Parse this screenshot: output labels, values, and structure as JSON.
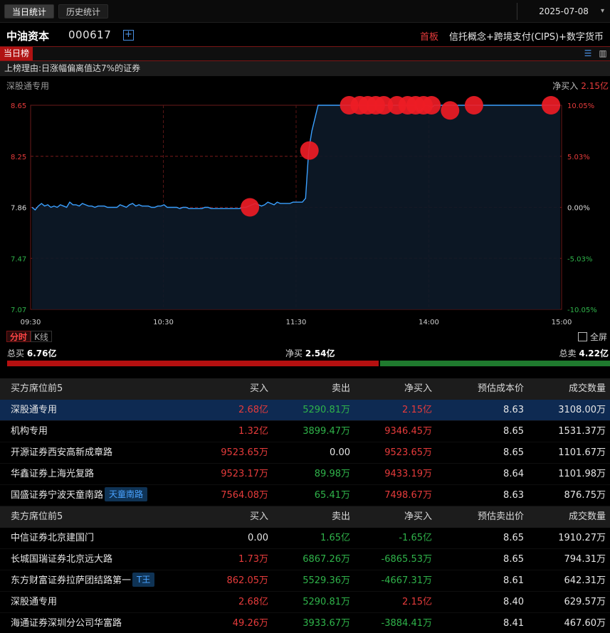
{
  "tabs": [
    {
      "label": "当日统计",
      "active": true
    },
    {
      "label": "历史统计",
      "active": false
    }
  ],
  "date": "2025-07-08",
  "stock": {
    "name": "中油资本",
    "code": "000617",
    "board": "首板",
    "concept": "信托概念+跨境支付(CIPS)+数字货币"
  },
  "rank_tag": "当日榜",
  "reason": "上榜理由:日涨幅偏离值达7%的证券",
  "seat_name": "深股通专用",
  "net_buy_label": "净买入",
  "net_buy_value": "2.15亿",
  "chart_data": {
    "type": "line",
    "y_labels": [
      "8.65",
      "8.25",
      "7.86",
      "7.47",
      "7.07"
    ],
    "pct_labels": [
      "10.05%",
      "5.03%",
      "0.00%",
      "-5.03%",
      "-10.05%"
    ],
    "x_labels": [
      "09:30",
      "10:30",
      "11:30",
      "14:00",
      "15:00"
    ],
    "ylim": [
      7.07,
      8.65
    ],
    "prev_close": 7.86,
    "series": [
      {
        "values": [
          7.86,
          7.84,
          7.87,
          7.89,
          7.87,
          7.88,
          7.86,
          7.87,
          7.86,
          7.88,
          7.87,
          7.86,
          7.9,
          7.88,
          7.88,
          7.87,
          7.89,
          7.88,
          7.87,
          7.87,
          7.86,
          7.87,
          7.87,
          7.87,
          7.86,
          7.86,
          7.86,
          7.86,
          7.88,
          7.87,
          7.86,
          7.88,
          7.89,
          7.87,
          7.88,
          7.87,
          7.87,
          7.87,
          7.86,
          7.86,
          7.87,
          7.87,
          7.88,
          7.86,
          7.86,
          7.86,
          7.86,
          7.85,
          7.86,
          7.86,
          7.85,
          7.85,
          7.85,
          7.85,
          7.85,
          7.86,
          7.86,
          7.85,
          7.85,
          7.85,
          7.85,
          7.85,
          7.85,
          7.85,
          7.85,
          7.85,
          7.85,
          7.86,
          7.86,
          7.87,
          7.88,
          7.89,
          7.88,
          7.87,
          7.88,
          7.9,
          7.89,
          7.88,
          7.9,
          7.89,
          7.89,
          7.89,
          7.89,
          7.9,
          7.9,
          7.9,
          7.9,
          7.93,
          8.3,
          8.45,
          8.55,
          8.65,
          8.65,
          8.65,
          8.65,
          8.65,
          8.65,
          8.65,
          8.65,
          8.65,
          8.65,
          8.65,
          8.65,
          8.65,
          8.65,
          8.65,
          8.65,
          8.65,
          8.65,
          8.65,
          8.65,
          8.65,
          8.65,
          8.65,
          8.65,
          8.65,
          8.65,
          8.65,
          8.65,
          8.65,
          8.65,
          8.65,
          8.65,
          8.6,
          8.62,
          8.65,
          8.65,
          8.63,
          8.65,
          8.65,
          8.65,
          8.65,
          8.65,
          8.65,
          8.65,
          8.65,
          8.65,
          8.65,
          8.65,
          8.65,
          8.65,
          8.65,
          8.65,
          8.65,
          8.65,
          8.65,
          8.65,
          8.65,
          8.65,
          8.65,
          8.65,
          8.65,
          8.65,
          8.65,
          8.65,
          8.65,
          8.65,
          8.65,
          8.65,
          8.65,
          8.65,
          8.65,
          8.65,
          8.65,
          8.65,
          8.65,
          8.65,
          8.65,
          8.65
        ]
      }
    ],
    "markers": [
      {
        "t": 0.413,
        "v": 7.86
      },
      {
        "t": 0.525,
        "v": 8.3
      },
      {
        "t": 0.6,
        "v": 8.65
      },
      {
        "t": 0.62,
        "v": 8.65
      },
      {
        "t": 0.635,
        "v": 8.65
      },
      {
        "t": 0.65,
        "v": 8.65
      },
      {
        "t": 0.665,
        "v": 8.65
      },
      {
        "t": 0.69,
        "v": 8.65
      },
      {
        "t": 0.71,
        "v": 8.65
      },
      {
        "t": 0.725,
        "v": 8.65
      },
      {
        "t": 0.74,
        "v": 8.65
      },
      {
        "t": 0.755,
        "v": 8.65
      },
      {
        "t": 0.79,
        "v": 8.61
      },
      {
        "t": 0.835,
        "v": 8.65
      },
      {
        "t": 0.98,
        "v": 8.65
      }
    ]
  },
  "chart_tabs": {
    "active": "分时",
    "inactive": "K线",
    "fullscreen": "全屏"
  },
  "summary": {
    "total_buy_label": "总买",
    "total_buy": "6.76亿",
    "net_buy_label": "净买",
    "net_buy": "2.54亿",
    "total_sell_label": "总卖",
    "total_sell": "4.22亿",
    "buy_ratio": 0.616
  },
  "buy_table": {
    "headers": [
      "买方席位前5",
      "买入",
      "卖出",
      "净买入",
      "预估成本价",
      "成交数量"
    ],
    "rows": [
      {
        "name": "深股通专用",
        "tag": "",
        "buy": "2.68亿",
        "sell": "5290.81万",
        "net": "2.15亿",
        "price": "8.63",
        "vol": "3108.00万",
        "hl": true
      },
      {
        "name": "机构专用",
        "tag": "",
        "buy": "1.32亿",
        "sell": "3899.47万",
        "net": "9346.45万",
        "price": "8.65",
        "vol": "1531.37万",
        "hl": false
      },
      {
        "name": "开源证券西安高新成章路",
        "tag": "",
        "buy": "9523.65万",
        "sell": "0.00",
        "net": "9523.65万",
        "price": "8.65",
        "vol": "1101.67万",
        "hl": false
      },
      {
        "name": "华鑫证券上海光复路",
        "tag": "",
        "buy": "9523.17万",
        "sell": "89.98万",
        "net": "9433.19万",
        "price": "8.64",
        "vol": "1101.98万",
        "hl": false
      },
      {
        "name": "国盛证券宁波天童南路",
        "tag": "天童南路",
        "buy": "7564.08万",
        "sell": "65.41万",
        "net": "7498.67万",
        "price": "8.63",
        "vol": "876.75万",
        "hl": false
      }
    ]
  },
  "sell_table": {
    "headers": [
      "卖方席位前5",
      "买入",
      "卖出",
      "净买入",
      "预估卖出价",
      "成交数量"
    ],
    "rows": [
      {
        "name": "中信证券北京建国门",
        "tag": "",
        "buy": "0.00",
        "sell": "1.65亿",
        "net": "-1.65亿",
        "price": "8.65",
        "vol": "1910.27万"
      },
      {
        "name": "长城国瑞证券北京远大路",
        "tag": "",
        "buy": "1.73万",
        "sell": "6867.26万",
        "net": "-6865.53万",
        "price": "8.65",
        "vol": "794.31万"
      },
      {
        "name": "东方财富证券拉萨团结路第一",
        "tag": "T王",
        "buy": "862.05万",
        "sell": "5529.36万",
        "net": "-4667.31万",
        "price": "8.61",
        "vol": "642.31万"
      },
      {
        "name": "深股通专用",
        "tag": "",
        "buy": "2.68亿",
        "sell": "5290.81万",
        "net": "2.15亿",
        "price": "8.40",
        "vol": "629.57万"
      },
      {
        "name": "海通证券深圳分公司华富路",
        "tag": "",
        "buy": "49.26万",
        "sell": "3933.67万",
        "net": "-3884.41万",
        "price": "8.41",
        "vol": "467.60万"
      }
    ]
  },
  "colors": {
    "up": "#e63b3b",
    "down": "#2fb34a",
    "line": "#3aa0ff",
    "marker": "#ee1c25"
  }
}
